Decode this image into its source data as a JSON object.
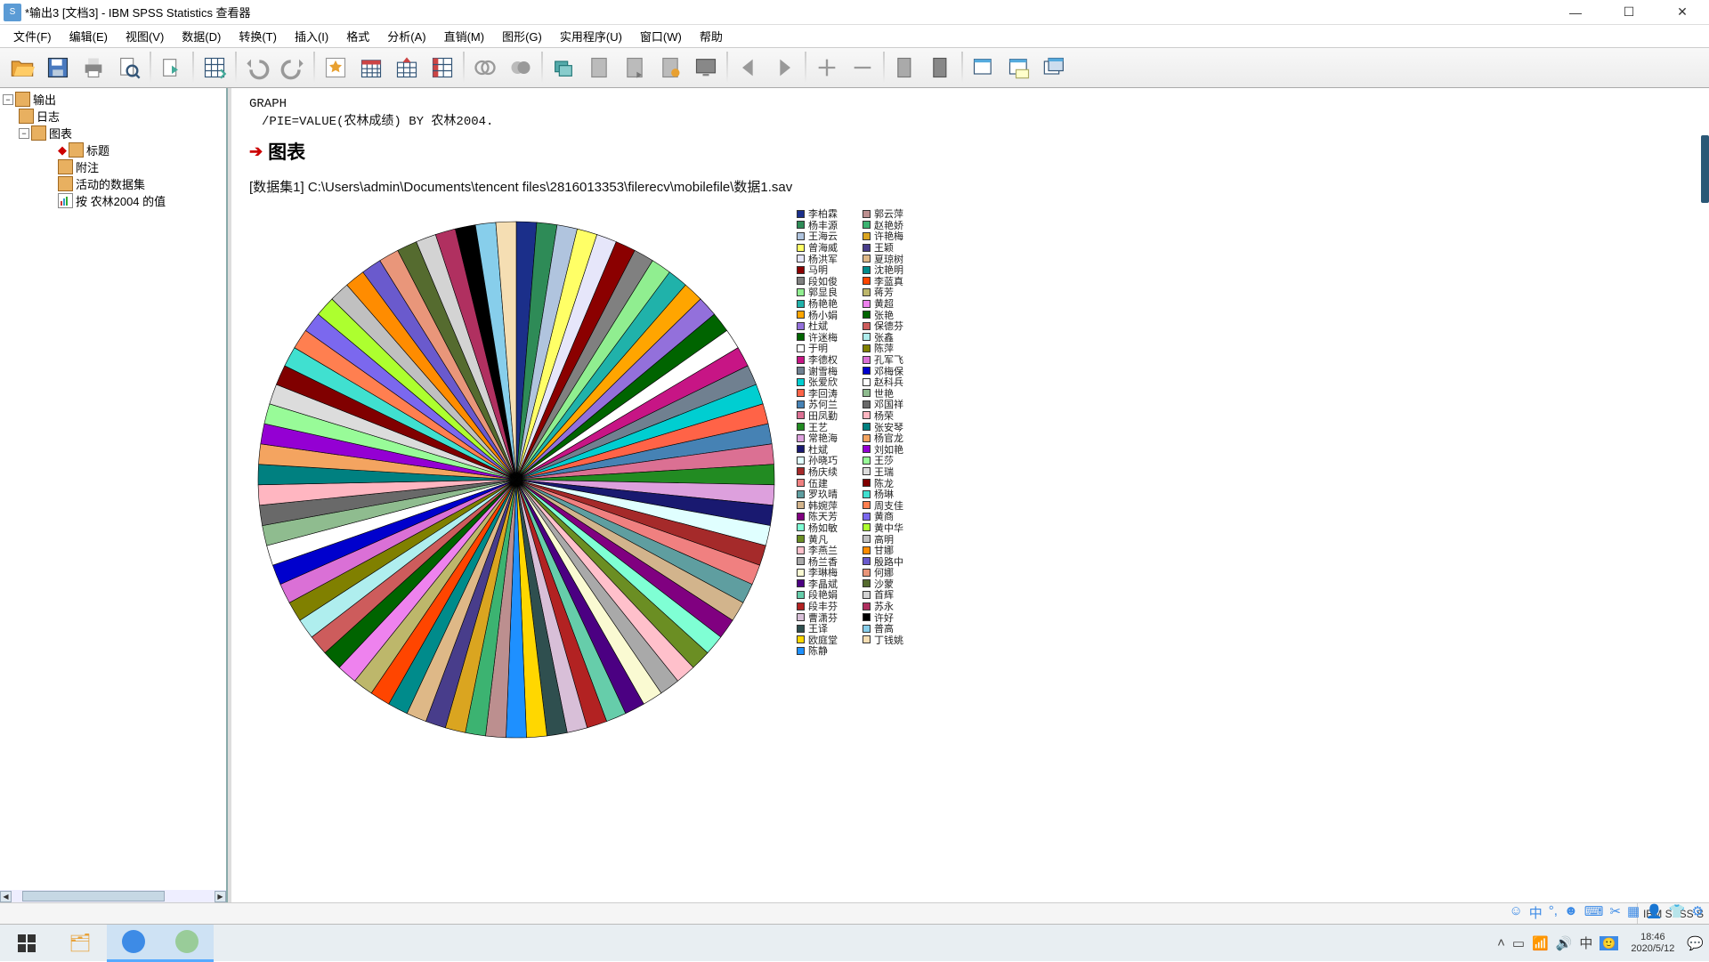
{
  "title": "*输出3 [文档3] - IBM SPSS Statistics 查看器",
  "menus": [
    "文件(F)",
    "编辑(E)",
    "视图(V)",
    "数据(D)",
    "转换(T)",
    "插入(I)",
    "格式",
    "分析(A)",
    "直销(M)",
    "图形(G)",
    "实用程序(U)",
    "窗口(W)",
    "帮助"
  ],
  "outline": {
    "root": "输出",
    "log": "日志",
    "chart_node": "图表",
    "title_node": "标题",
    "note_node": "附注",
    "active_dataset": "活动的数据集",
    "value_by": "按 农林2004 的值"
  },
  "syntax": {
    "line1": "GRAPH",
    "line2": "/PIE=VALUE(农林成绩) BY 农林2004."
  },
  "heading": "图表",
  "dataset": "[数据集1] C:\\Users\\admin\\Documents\\tencent files\\2816013353\\filerecv\\mobilefile\\数据1.sav",
  "chart_data": {
    "type": "pie",
    "title": "",
    "series": [
      {
        "name": "李柏霖",
        "value": 1,
        "color": "#1b2f8a"
      },
      {
        "name": "杨丰源",
        "value": 1,
        "color": "#2e8b57"
      },
      {
        "name": "王海云",
        "value": 1,
        "color": "#b0c4de"
      },
      {
        "name": "曾海威",
        "value": 1,
        "color": "#ffff66"
      },
      {
        "name": "杨洪军",
        "value": 1,
        "color": "#e6e6fa"
      },
      {
        "name": "马明",
        "value": 1,
        "color": "#8b0000"
      },
      {
        "name": "段如俊",
        "value": 1,
        "color": "#808080"
      },
      {
        "name": "郭显良",
        "value": 1,
        "color": "#90ee90"
      },
      {
        "name": "杨艳艳",
        "value": 1,
        "color": "#20b2aa"
      },
      {
        "name": "杨小娟",
        "value": 1,
        "color": "#ffa500"
      },
      {
        "name": "杜斌",
        "value": 1,
        "color": "#9370db"
      },
      {
        "name": "许迷梅",
        "value": 1,
        "color": "#006400"
      },
      {
        "name": "于明",
        "value": 1,
        "color": "#ffffff"
      },
      {
        "name": "李德权",
        "value": 1,
        "color": "#c71585"
      },
      {
        "name": "谢雪梅",
        "value": 1,
        "color": "#708090"
      },
      {
        "name": "张爱欣",
        "value": 1,
        "color": "#00ced1"
      },
      {
        "name": "李回涛",
        "value": 1,
        "color": "#ff6347"
      },
      {
        "name": "苏何兰",
        "value": 1,
        "color": "#4682b4"
      },
      {
        "name": "田凤勤",
        "value": 1,
        "color": "#db7093"
      },
      {
        "name": "王艺",
        "value": 1,
        "color": "#228b22"
      },
      {
        "name": "常艳海",
        "value": 1,
        "color": "#dda0dd"
      },
      {
        "name": "杜斌",
        "value": 1,
        "color": "#191970"
      },
      {
        "name": "孙晓巧",
        "value": 1,
        "color": "#e0ffff"
      },
      {
        "name": "杨庆续",
        "value": 1,
        "color": "#a52a2a"
      },
      {
        "name": "伍建",
        "value": 1,
        "color": "#f08080"
      },
      {
        "name": "罗玖晴",
        "value": 1,
        "color": "#5f9ea0"
      },
      {
        "name": "韩婉萍",
        "value": 1,
        "color": "#d2b48c"
      },
      {
        "name": "陈天芳",
        "value": 1,
        "color": "#800080"
      },
      {
        "name": "杨如敏",
        "value": 1,
        "color": "#7fffd4"
      },
      {
        "name": "黄凡",
        "value": 1,
        "color": "#6b8e23"
      },
      {
        "name": "李燕兰",
        "value": 1,
        "color": "#ffc0cb"
      },
      {
        "name": "杨兰香",
        "value": 1,
        "color": "#a9a9a9"
      },
      {
        "name": "李琳梅",
        "value": 1,
        "color": "#fafad2"
      },
      {
        "name": "李晶斌",
        "value": 1,
        "color": "#4b0082"
      },
      {
        "name": "段艳娟",
        "value": 1,
        "color": "#66cdaa"
      },
      {
        "name": "段丰芬",
        "value": 1,
        "color": "#b22222"
      },
      {
        "name": "曹潇芬",
        "value": 1,
        "color": "#d8bfd8"
      },
      {
        "name": "王译",
        "value": 1,
        "color": "#2f4f4f"
      },
      {
        "name": "欧庭堂",
        "value": 1,
        "color": "#ffd700"
      },
      {
        "name": "陈静",
        "value": 1,
        "color": "#1e90ff"
      },
      {
        "name": "郭云萍",
        "value": 1,
        "color": "#bc8f8f"
      },
      {
        "name": "赵艳娇",
        "value": 1,
        "color": "#3cb371"
      },
      {
        "name": "许艳梅",
        "value": 1,
        "color": "#daa520"
      },
      {
        "name": "王颖",
        "value": 1,
        "color": "#483d8b"
      },
      {
        "name": "夏琼树",
        "value": 1,
        "color": "#deb887"
      },
      {
        "name": "沈艳明",
        "value": 1,
        "color": "#008b8b"
      },
      {
        "name": "李蓝真",
        "value": 1,
        "color": "#ff4500"
      },
      {
        "name": "蒋芳",
        "value": 1,
        "color": "#bdb76b"
      },
      {
        "name": "黄超",
        "value": 1,
        "color": "#ee82ee"
      },
      {
        "name": "张艳",
        "value": 1,
        "color": "#006400"
      },
      {
        "name": "保德芬",
        "value": 1,
        "color": "#cd5c5c"
      },
      {
        "name": "张鑫",
        "value": 1,
        "color": "#afeeee"
      },
      {
        "name": "陈萍",
        "value": 1,
        "color": "#808000"
      },
      {
        "name": "孔军飞",
        "value": 1,
        "color": "#da70d6"
      },
      {
        "name": "邓梅保",
        "value": 1,
        "color": "#0000cd"
      },
      {
        "name": "赵科兵",
        "value": 1,
        "color": "#ffffff"
      },
      {
        "name": "世艳",
        "value": 1,
        "color": "#8fbc8f"
      },
      {
        "name": "邓国祥",
        "value": 1,
        "color": "#696969"
      },
      {
        "name": "杨荣",
        "value": 1,
        "color": "#ffb6c1"
      },
      {
        "name": "张安琴",
        "value": 1,
        "color": "#008080"
      },
      {
        "name": "杨官龙",
        "value": 1,
        "color": "#f4a460"
      },
      {
        "name": "刘如艳",
        "value": 1,
        "color": "#9400d3"
      },
      {
        "name": "王莎",
        "value": 1,
        "color": "#98fb98"
      },
      {
        "name": "王瑞",
        "value": 1,
        "color": "#dcdcdc"
      },
      {
        "name": "陈龙",
        "value": 1,
        "color": "#800000"
      },
      {
        "name": "杨琳",
        "value": 1,
        "color": "#40e0d0"
      },
      {
        "name": "周支佳",
        "value": 1,
        "color": "#ff7f50"
      },
      {
        "name": "黄商",
        "value": 1,
        "color": "#7b68ee"
      },
      {
        "name": "黄中华",
        "value": 1,
        "color": "#adff2f"
      },
      {
        "name": "高明",
        "value": 1,
        "color": "#c0c0c0"
      },
      {
        "name": "甘娜",
        "value": 1,
        "color": "#ff8c00"
      },
      {
        "name": "殷路中",
        "value": 1,
        "color": "#6a5acd"
      },
      {
        "name": "何娜",
        "value": 1,
        "color": "#e9967a"
      },
      {
        "name": "沙蒙",
        "value": 1,
        "color": "#556b2f"
      },
      {
        "name": "首辉",
        "value": 1,
        "color": "#d3d3d3"
      },
      {
        "name": "苏永",
        "value": 1,
        "color": "#b03060"
      },
      {
        "name": "许好",
        "value": 1,
        "color": "#000000"
      },
      {
        "name": "普高",
        "value": 1,
        "color": "#87ceeb"
      },
      {
        "name": "丁钱姚",
        "value": 1,
        "color": "#f5deb3"
      }
    ]
  },
  "status": {
    "processor": "IBM SPSS S"
  },
  "system_tray": {
    "time": "18:46",
    "date": "2020/5/12"
  }
}
